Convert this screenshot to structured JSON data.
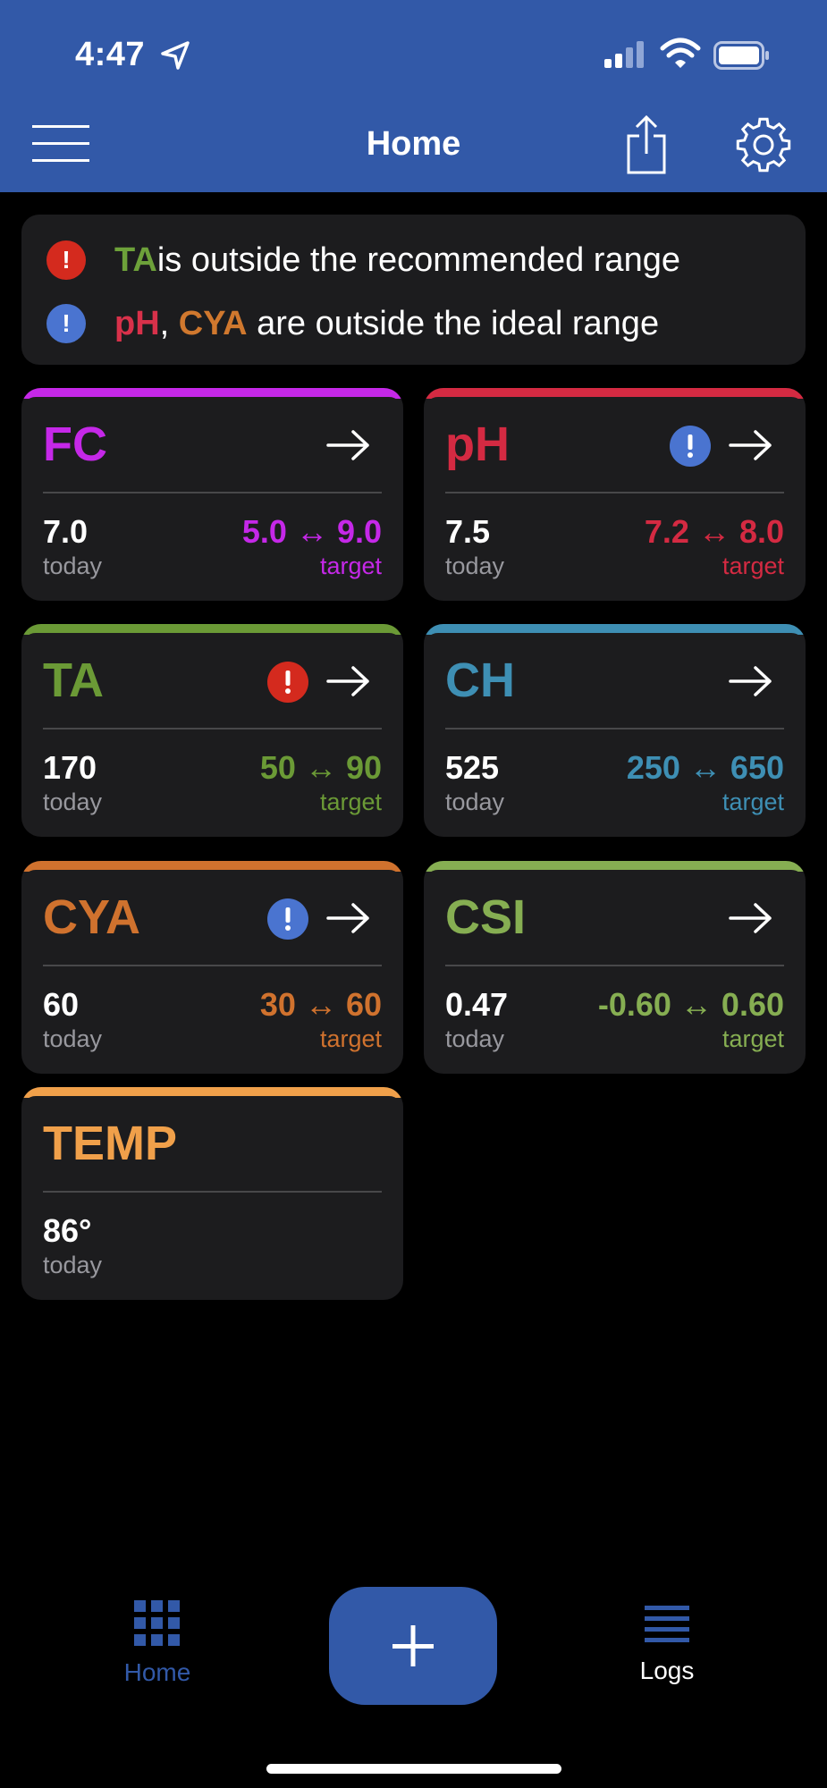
{
  "status_bar": {
    "time": "4:47"
  },
  "header": {
    "title": "Home"
  },
  "alerts": [
    {
      "severity": "red",
      "highlights": [
        {
          "text": "TA",
          "color": "#6DA13A"
        }
      ],
      "separator": "",
      "message": " is outside the recommended range"
    },
    {
      "severity": "blue",
      "highlights": [
        {
          "text": "pH",
          "color": "#D8314A"
        },
        {
          "text": "CYA",
          "color": "#D0782E"
        }
      ],
      "separator": ", ",
      "message": " are outside the ideal range"
    }
  ],
  "cards": [
    {
      "id": "fc",
      "name": "FC",
      "color": "#C528E8",
      "value": "7.0",
      "value_label": "today",
      "range": "5.0 ↔ 9.0",
      "range_label": "target",
      "warning": null
    },
    {
      "id": "ph",
      "name": "pH",
      "color": "#D42A42",
      "value": "7.5",
      "value_label": "today",
      "range": "7.2 ↔ 8.0",
      "range_label": "target",
      "warning": "blue"
    },
    {
      "id": "ta",
      "name": "TA",
      "color": "#6B9A36",
      "value": "170",
      "value_label": "today",
      "range": "50 ↔ 90",
      "range_label": "target",
      "warning": "red"
    },
    {
      "id": "ch",
      "name": "CH",
      "color": "#3E8FB4",
      "value": "525",
      "value_label": "today",
      "range": "250 ↔ 650",
      "range_label": "target",
      "warning": null
    },
    {
      "id": "cya",
      "name": "CYA",
      "color": "#D0722E",
      "value": "60",
      "value_label": "today",
      "range": "30 ↔ 60",
      "range_label": "target",
      "warning": "blue"
    },
    {
      "id": "csi",
      "name": "CSI",
      "color": "#86AE52",
      "value": "0.47",
      "value_label": "today",
      "range": "-0.60 ↔ 0.60",
      "range_label": "target",
      "warning": null
    },
    {
      "id": "temp",
      "name": "TEMP",
      "color": "#F0A04A",
      "value": "86°",
      "value_label": "today",
      "range": null,
      "range_label": null,
      "warning": null
    }
  ],
  "tabbar": {
    "home_label": "Home",
    "logs_label": "Logs",
    "active_color": "#3259A8"
  },
  "icons": [
    "location-arrow-icon",
    "signal-icon",
    "wifi-icon",
    "battery-icon",
    "menu-icon",
    "share-icon",
    "gear-icon",
    "arrow-right-icon",
    "alert-icon",
    "grid-icon",
    "plus-icon",
    "list-icon"
  ]
}
